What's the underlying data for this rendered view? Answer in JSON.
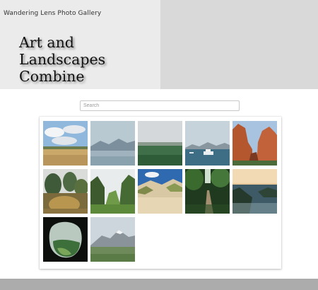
{
  "header": {
    "brand": "Wandering Lens Photo Gallery",
    "headline": [
      "Art and",
      "Landscapes",
      "Combine"
    ]
  },
  "search": {
    "placeholder": "Search",
    "value": ""
  },
  "gallery": {
    "photos": [
      {
        "subject": "golden field under blue sky with clouds"
      },
      {
        "subject": "misty lake with mountains"
      },
      {
        "subject": "green meadow under overcast sky"
      },
      {
        "subject": "boat on icy lake with mountains"
      },
      {
        "subject": "red rock canyon cliffs"
      },
      {
        "subject": "garden with shrubs and tall grass"
      },
      {
        "subject": "green hills and valley"
      },
      {
        "subject": "sandy dunes with grass"
      },
      {
        "subject": "forest path through trees"
      },
      {
        "subject": "coastline at sunset"
      },
      {
        "subject": "view through dark cave opening"
      },
      {
        "subject": "snowy mountain over green field"
      }
    ]
  },
  "colors": {
    "footer": "#acacac",
    "hero_left": "#ebebeb",
    "hero_right": "#d9d9d9"
  }
}
